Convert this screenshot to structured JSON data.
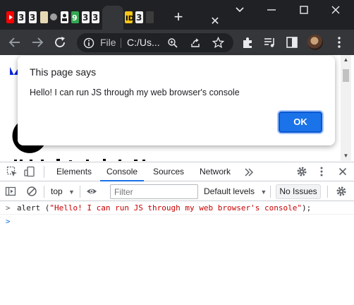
{
  "browser": {
    "tab_favicons": [
      {
        "name": "youtube-favicon",
        "color": "#ff0000"
      },
      {
        "name": "site-favicon-1",
        "color": "#f2f2f2"
      },
      {
        "name": "site-favicon-2",
        "color": "#f2f2f2"
      },
      {
        "name": "site-favicon-3",
        "color": "#e8d9b5"
      },
      {
        "name": "site-favicon-4",
        "color": "#9e9e9e"
      },
      {
        "name": "site-favicon-5",
        "color": "#ffffff"
      },
      {
        "name": "site-favicon-6",
        "color": "#34a853"
      },
      {
        "name": "site-favicon-7",
        "color": "#f2f2f2"
      },
      {
        "name": "site-favicon-8",
        "color": "#f2f2f2"
      }
    ],
    "address": {
      "info_label": "File",
      "url": "C:/Us..."
    },
    "accent": "#1a73e8"
  },
  "dialog": {
    "title": "This page says",
    "message": "Hello! I can run JS through my web browser's console",
    "ok_label": "OK"
  },
  "devtools": {
    "tabs": [
      {
        "label": "Elements",
        "active": false
      },
      {
        "label": "Console",
        "active": true
      },
      {
        "label": "Sources",
        "active": false
      },
      {
        "label": "Network",
        "active": false
      }
    ],
    "more_tabs_icon": "double-chevron-right-icon",
    "context": "top",
    "filter_placeholder": "Filter",
    "levels_label": "Default levels",
    "issues_label": "No Issues"
  },
  "console": {
    "command_fn": "alert (",
    "command_string": "\"Hello! I can run JS through my web browser's console\"",
    "command_end": ");"
  }
}
